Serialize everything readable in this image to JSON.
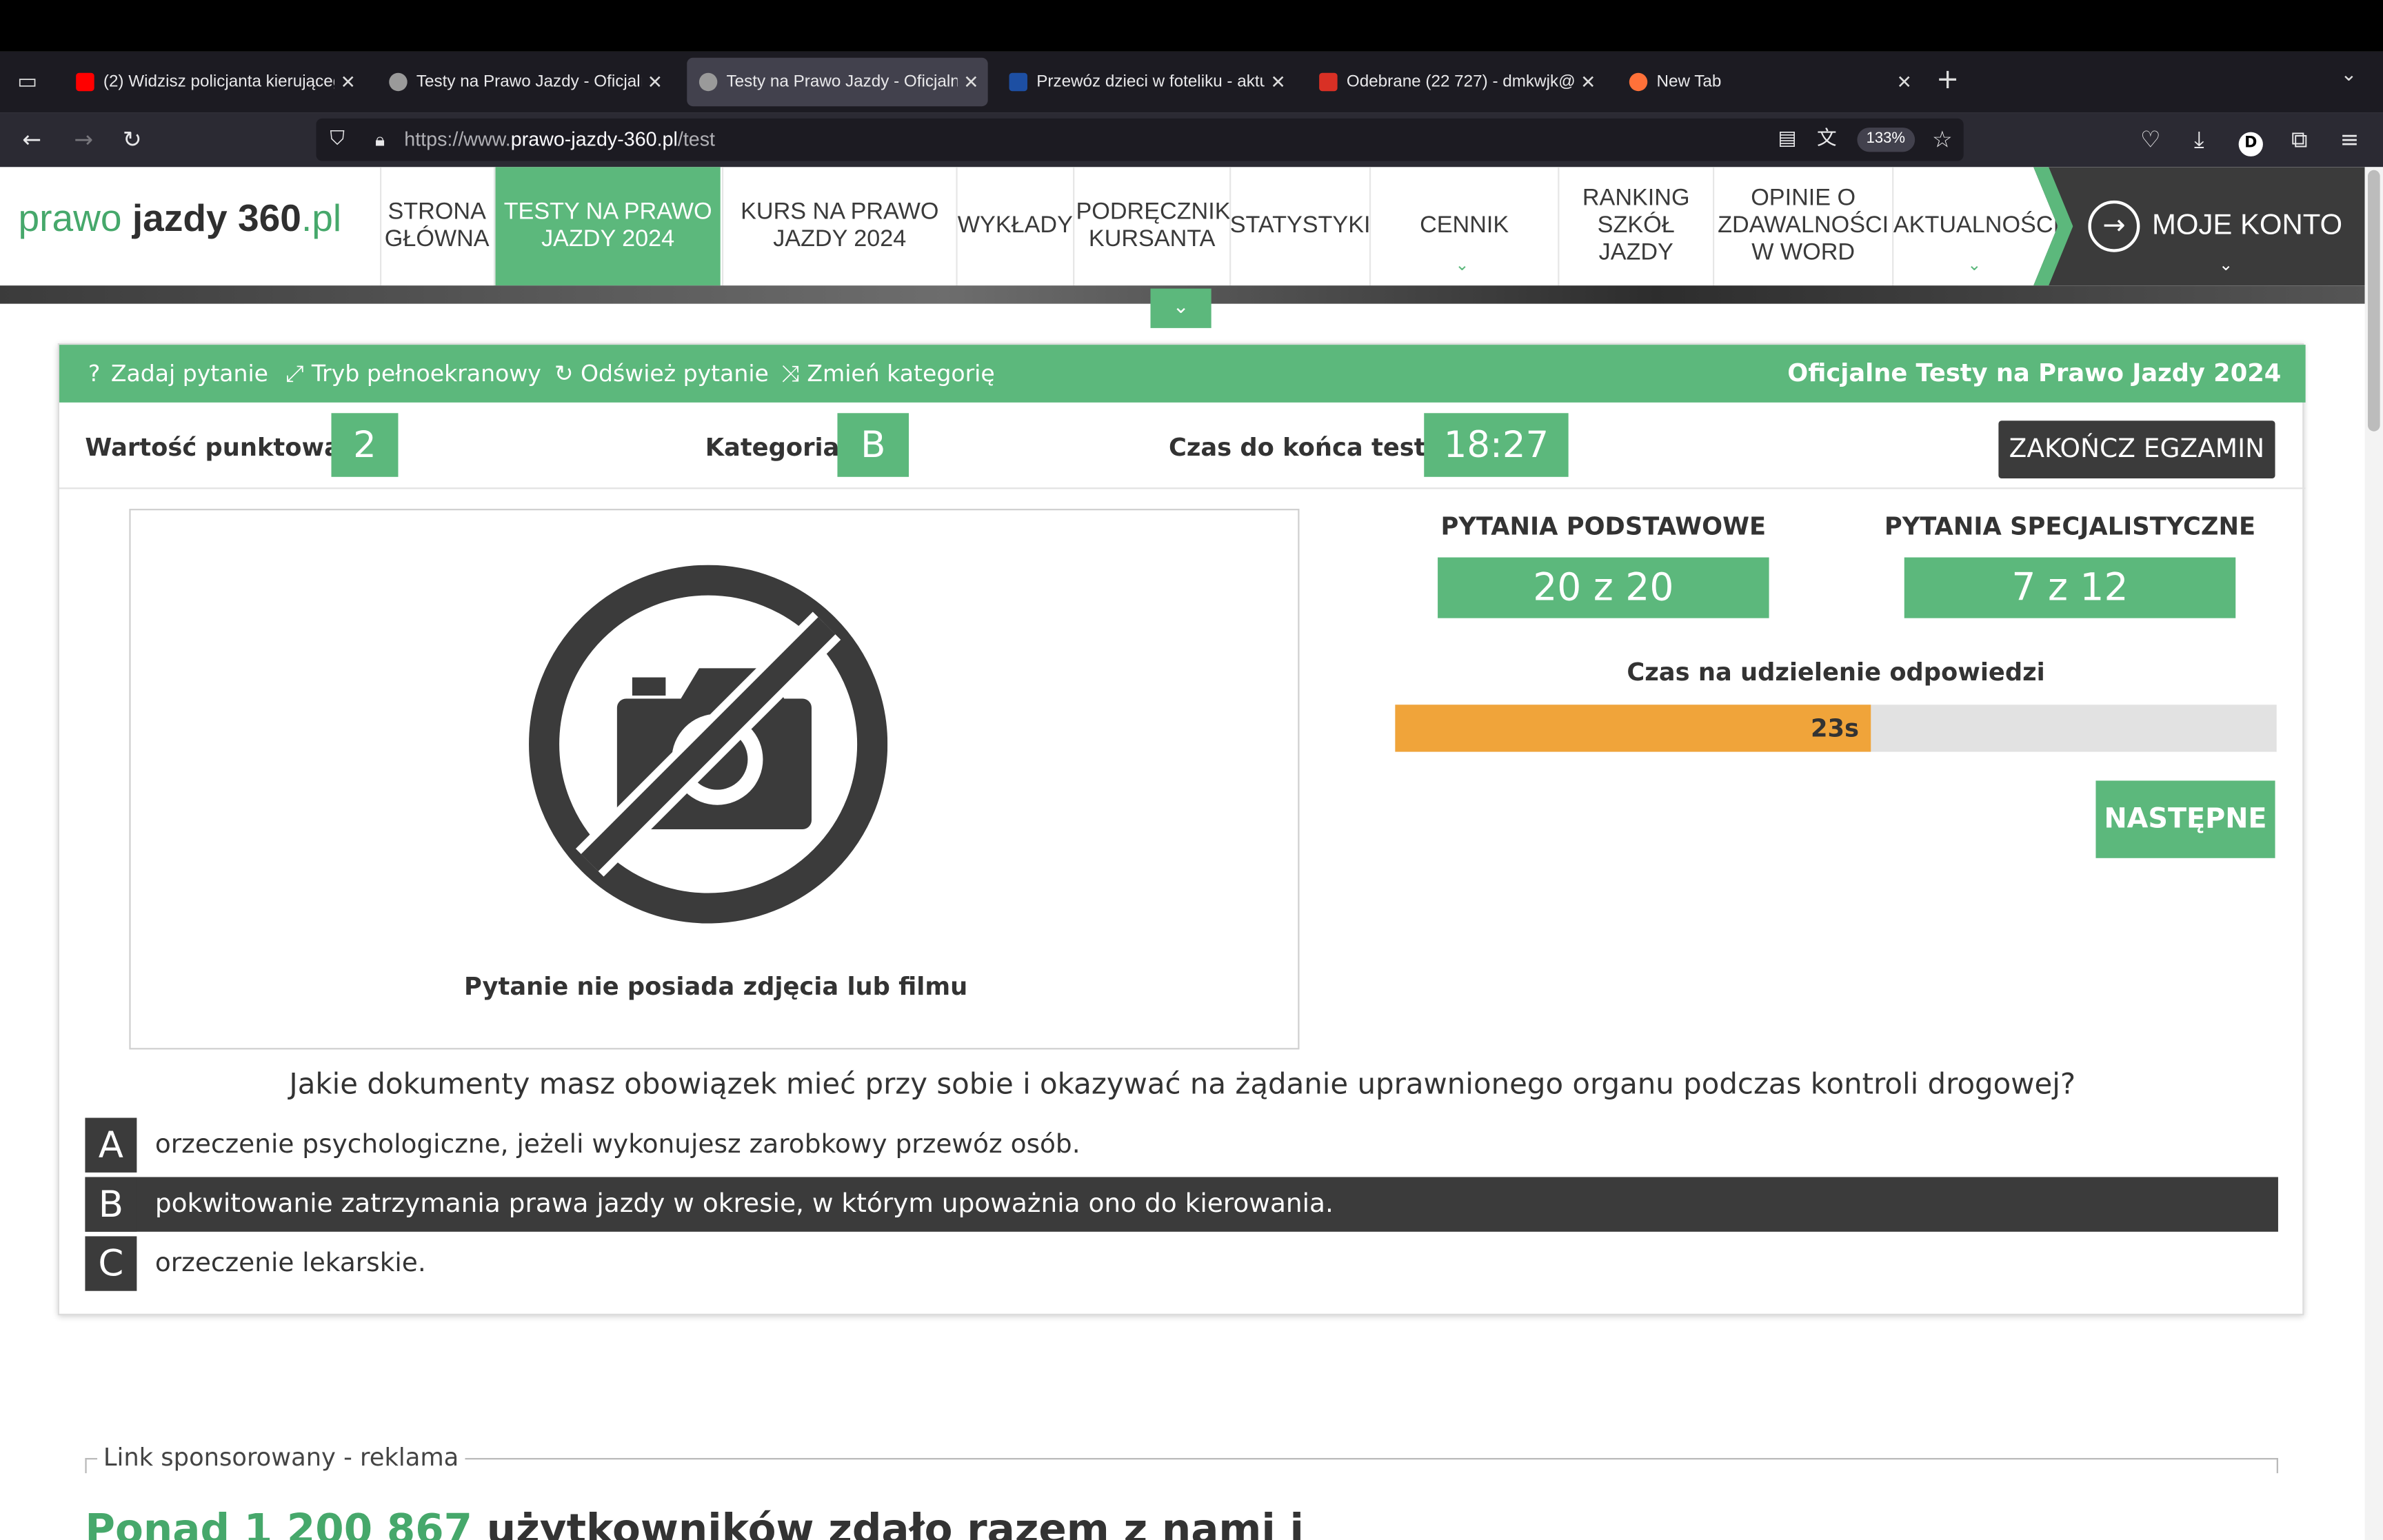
{
  "browser": {
    "tabs": [
      {
        "title": "(2) Widzisz policjanta kierującego",
        "favicon_color": "#ff0000",
        "active": false
      },
      {
        "title": "Testy na Prawo Jazdy - Oficjalne",
        "favicon_color": "#9a9a9a",
        "active": false
      },
      {
        "title": "Testy na Prawo Jazdy - Oficjalne",
        "favicon_color": "#9a9a9a",
        "active": true
      },
      {
        "title": "Przewóz dzieci w foteliku - aktu",
        "favicon_color": "#1d4fa3",
        "active": false
      },
      {
        "title": "Odebrane (22 727) - dmkwjk@g",
        "favicon_color": "#d93025",
        "active": false
      },
      {
        "title": "New Tab",
        "favicon_color": "#ff7139",
        "active": false
      }
    ],
    "url_prefix": "https://www.",
    "url_domain": "prawo-jazdy-360.pl",
    "url_path": "/test",
    "zoom": "133%"
  },
  "site": {
    "logo_word1": "prawo",
    "logo_word2": "jazdy",
    "logo_num": "360",
    "logo_tld": ".pl",
    "menu": [
      {
        "label": "STRONA GŁÓWNA",
        "active": false
      },
      {
        "label": "TESTY NA PRAWO JAZDY 2024",
        "active": true
      },
      {
        "label": "KURS NA PRAWO JAZDY 2024",
        "active": false
      },
      {
        "label": "WYKŁADY",
        "active": false
      },
      {
        "label": "PODRĘCZNIK KURSANTA",
        "active": false
      },
      {
        "label": "STATYSTYKI",
        "active": false
      },
      {
        "label": "CENNIK",
        "active": false
      },
      {
        "label": "RANKING SZKÓŁ JAZDY",
        "active": false
      },
      {
        "label": "OPINIE O ZDAWALNOŚCI W WORD",
        "active": false
      },
      {
        "label": "AKTUALNOŚCI",
        "active": false
      }
    ],
    "account_label": "MOJE KONTO"
  },
  "toolbar": {
    "ask": "Zadaj pytanie",
    "fullscreen": "Tryb pełnoekranowy",
    "refresh": "Odśwież pytanie",
    "change_category": "Zmień kategorię",
    "title": "Oficjalne Testy na Prawo Jazdy 2024"
  },
  "exam": {
    "points_label": "Wartość punktowa",
    "points_value": "2",
    "category_label": "Kategoria",
    "category_value": "B",
    "time_label": "Czas do końca testu",
    "time_value": "18:27",
    "end_button": "ZAKOŃCZ EGZAMIN",
    "basic_label": "PYTANIA PODSTAWOWE",
    "basic_value": "20 z 20",
    "special_label": "PYTANIA SPECJALISTYCZNE",
    "special_value": "7 z 12",
    "answer_time_label": "Czas na udzielenie odpowiedzi",
    "answer_time_value": "23s",
    "answer_time_fraction": 0.54,
    "next_button": "NASTĘPNE",
    "no_media_caption": "Pytanie nie posiada zdjęcia lub filmu",
    "question": "Jakie dokumenty masz obowiązek mieć przy sobie i okazywać na żądanie uprawnionego organu podczas kontroli drogowej?",
    "answers": [
      {
        "letter": "A",
        "text": "orzeczenie psychologiczne, jeżeli wykonujesz zarobkowy przewóz osób.",
        "selected": false
      },
      {
        "letter": "B",
        "text": "pokwitowanie zatrzymania prawa jazdy w okresie, w którym upoważnia ono do kierowania.",
        "selected": true
      },
      {
        "letter": "C",
        "text": "orzeczenie lekarskie.",
        "selected": false
      }
    ]
  },
  "below": {
    "sponsored_label": "Link sponsorowany - reklama",
    "headline_green": "Ponad 1 200 867",
    "headline_rest": " użytkowników zdało razem z nami i"
  },
  "colors": {
    "brand_green": "#5cb87c",
    "dark": "#3b3b3b",
    "progress_orange": "#f0a43a"
  }
}
